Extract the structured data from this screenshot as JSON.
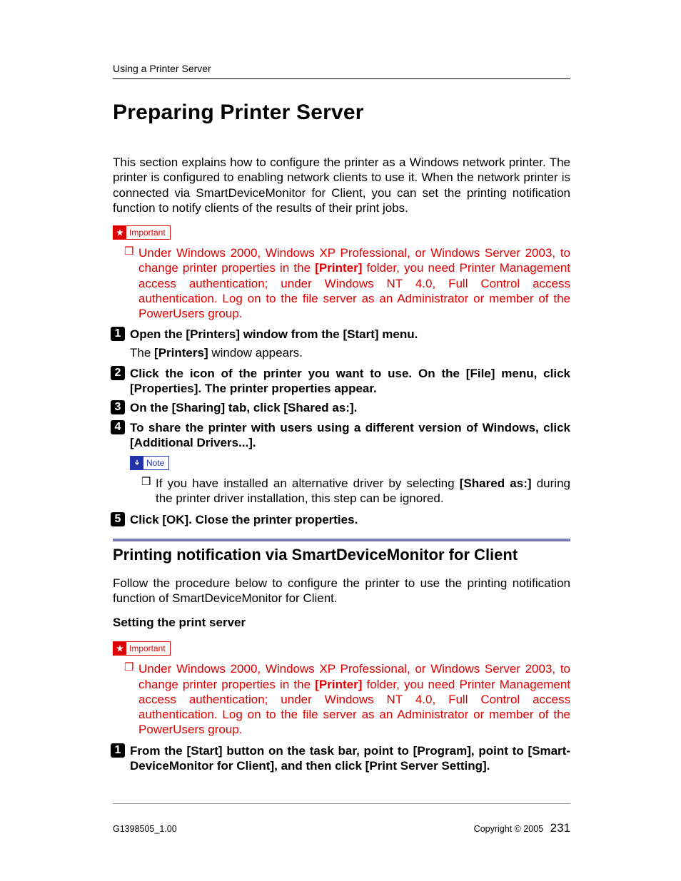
{
  "running_head": "Using a Printer Server",
  "title": "Preparing Printer Server",
  "intro": "This section explains how to configure the printer as a Windows network printer. The printer is configured to enabling network clients to use it. When the network printer is connected via SmartDeviceMonitor for Client, you can set the printing notification function to notify clients of the results of their print jobs.",
  "callouts": {
    "important": "Important",
    "note": "Note"
  },
  "important_item": {
    "pre": "Under Windows 2000, Windows XP Professional, or Windows Server 2003, to change printer properties in the ",
    "printer": "[Printer]",
    "post": " folder, you need Printer Management access authentication; under Windows NT 4.0, Full Control access authentication. Log on to the file server as an Administrator or member of the PowerUsers group."
  },
  "steps": {
    "s1": {
      "a": "Open the ",
      "printers": "[Printers]",
      "b": " window from the ",
      "start": "[Start]",
      "c": " menu."
    },
    "s1_sub": {
      "a": "The ",
      "printers": "[Printers]",
      "b": " window appears."
    },
    "s2": {
      "a": "Click the icon of the printer you want to use. On the ",
      "file": "[File]",
      "b": " menu, click ",
      "props": "[Properties]",
      "c": ". The printer properties appear."
    },
    "s3": {
      "a": "On the ",
      "sharing": "[Sharing]",
      "b": " tab, click ",
      "sharedas": "[Shared as:]",
      "c": "."
    },
    "s4": {
      "a": "To share the printer with users using a different version of Windows, click ",
      "drivers": "[Additional Drivers...]",
      "b": "."
    },
    "s4_note": {
      "a": "If you have installed an alternative driver by selecting ",
      "sharedas": "[Shared as:]",
      "b": " during the printer driver installation, this step can be ignored."
    },
    "s5": {
      "a": "Click ",
      "ok": "[OK]",
      "b": ". Close the printer properties."
    }
  },
  "section2": {
    "heading": "Printing notification via SmartDeviceMonitor for Client",
    "intro": "Follow the procedure below to configure the printer to use the printing notification function of SmartDeviceMonitor for Client.",
    "subheading": "Setting the print server",
    "step1": {
      "a": "From the ",
      "start": "[Start]",
      "b": " button on the task bar, point to ",
      "program": "[Program]",
      "c": ", point to ",
      "sdm": "[Smart-DeviceMonitor for Client]",
      "d": ", and then click ",
      "pss": "[Print Server Setting]",
      "e": "."
    }
  },
  "footer": {
    "left": "G1398505_1.00",
    "right_label": "Copyright © 2005",
    "page": "231"
  }
}
